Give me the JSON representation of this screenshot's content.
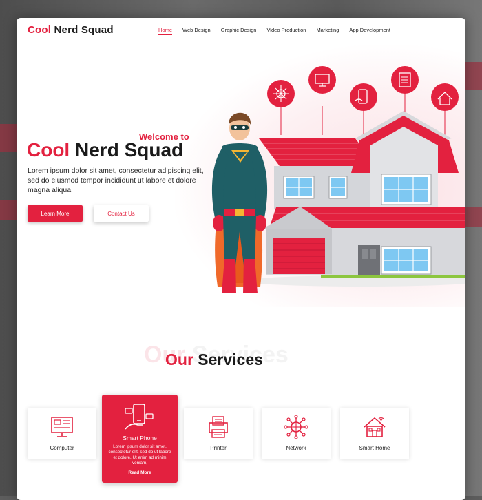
{
  "brand": {
    "first": "Cool",
    "rest": " Nerd Squad"
  },
  "nav": {
    "items": [
      {
        "label": "Home",
        "active": true
      },
      {
        "label": "Web Design",
        "active": false
      },
      {
        "label": "Graphic Design",
        "active": false
      },
      {
        "label": "Video Production",
        "active": false
      },
      {
        "label": "Marketing",
        "active": false
      },
      {
        "label": "App Development",
        "active": false
      }
    ]
  },
  "hero": {
    "welcome": "Welcome to",
    "title_first": "Cool",
    "title_rest": " Nerd Squad",
    "text": "Lorem ipsum dolor sit amet, consectetur adipiscing elit, sed do eiusmod tempor incididunt ut labore et dolore magna aliqua.",
    "primary_button": "Learn More",
    "secondary_button": "Contact Us"
  },
  "services": {
    "ghost_first": "Our",
    "ghost_rest": " Services",
    "title_first": "Our",
    "title_rest": " Services",
    "items": [
      {
        "label": "Computer",
        "icon": "computer-icon"
      },
      {
        "label": "Smart Phone",
        "icon": "smartphone-icon",
        "highlighted": true,
        "description": "Lorem ipsum dolor sit amet, consectetur elit, sed do ut labore et dolore. Ut enim ad minim veniam,",
        "link": "Read More"
      },
      {
        "label": "Printer",
        "icon": "printer-icon"
      },
      {
        "label": "Network",
        "icon": "network-icon"
      },
      {
        "label": "Smart Home",
        "icon": "smart-home-icon"
      }
    ]
  },
  "colors": {
    "accent": "#e3213f",
    "text": "#1a1a1a",
    "hero_tint": "#fbe1e5"
  }
}
